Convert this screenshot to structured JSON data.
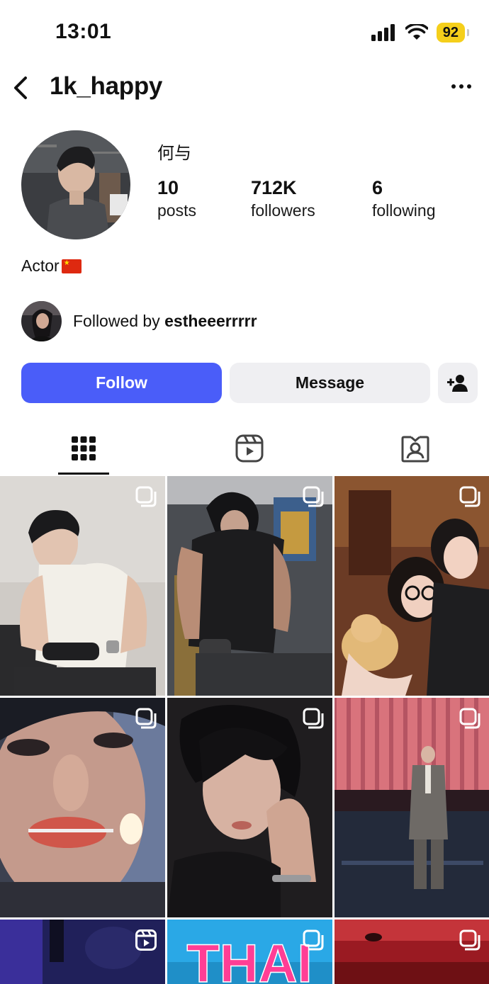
{
  "status_bar": {
    "time": "13:01",
    "battery": "92"
  },
  "header": {
    "username": "1k_happy"
  },
  "profile": {
    "display_name": "何与",
    "stats": [
      {
        "value": "10",
        "label": "posts"
      },
      {
        "value": "712K",
        "label": "followers"
      },
      {
        "value": "6",
        "label": "following"
      }
    ],
    "bio": "Actor",
    "followed_by": {
      "prefix": "Followed by ",
      "name": "estheeerrrrr"
    }
  },
  "buttons": {
    "follow": "Follow",
    "message": "Message"
  },
  "colors": {
    "follow_button": "#4a5df9",
    "secondary_button": "#efeff2",
    "battery": "#f5cf1b"
  },
  "tabs": [
    "posts-grid-icon",
    "reels-icon",
    "tagged-icon"
  ],
  "posts": [
    {
      "badge": "carousel-icon"
    },
    {
      "badge": "carousel-icon"
    },
    {
      "badge": "carousel-icon"
    },
    {
      "badge": "carousel-icon"
    },
    {
      "badge": "carousel-icon"
    },
    {
      "badge": "carousel-icon"
    },
    {
      "badge": "reel-icon"
    },
    {
      "badge": "carousel-icon",
      "text": "THAI"
    },
    {
      "badge": "carousel-icon"
    }
  ]
}
